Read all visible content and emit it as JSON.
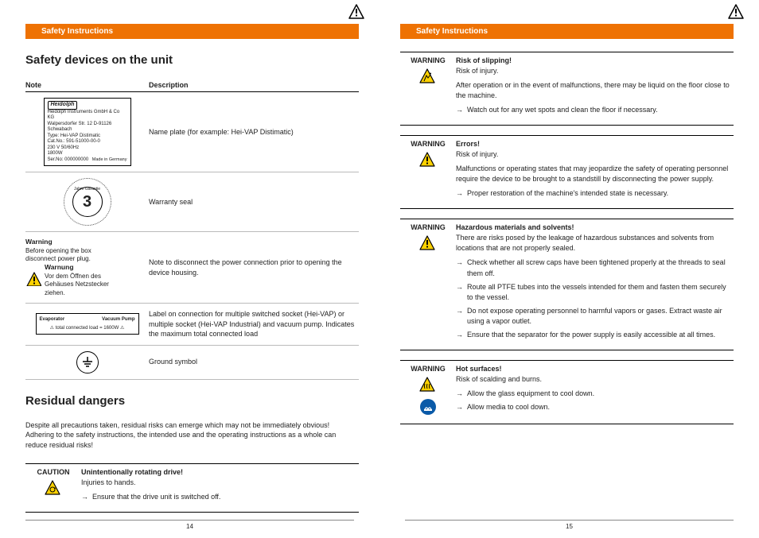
{
  "header": "Safety Instructions",
  "left": {
    "h1": "Safety devices on the unit",
    "th_note": "Note",
    "th_desc": "Description",
    "nameplate": {
      "brand": "Heidolph",
      "company": "Heidolph Instruments GmbH & Co KG",
      "addr": "Walpersdorfer Str. 12 D-91126 Schwabach",
      "type": "Type: Hei-VAP Distimatic",
      "cat": "Cat.No.: 591-51000-00-0",
      "volt": "230 V        50/60Hz",
      "watt": "1800W",
      "ser": "Ser.No: 000000000",
      "made": "Made in Germany"
    },
    "row1_desc": "Name plate (for example: Hei-VAP Distimatic)",
    "warranty_num": "3",
    "warranty_arc": "Jahre Garantie",
    "row2_desc": "Warranty seal",
    "wlabel": {
      "t1": "Warning",
      "l1": "Before opening the box disconnect power plug.",
      "t2": "Warnung",
      "l2": "Vor dem Öffnen des Gehäuses  Netzstecker ziehen."
    },
    "row3_desc": "Note to disconnect the power connection prior to opening the device housing.",
    "socket": {
      "a": "Evaporator",
      "b": "Vacuum Pump",
      "c": "⚠ total connected load = 1600W ⚠"
    },
    "row4_desc": "Label on connection for multiple switched socket (Hei-VAP) or multiple socket (Hei-VAP Industrial) and vacuum pump. Indicates the maximum total connected load",
    "row5_desc": "Ground symbol",
    "h2": "Residual dangers",
    "intro": "Despite all precautions taken, residual risks can emerge which may not be immediately obvious! Adhering to the safety instructions, the intended use and the operating instructions as a whole can reduce residual risks!",
    "caution": {
      "level": "CAUTION",
      "title": "Unintentionally rotating drive!",
      "sub": "Injuries to hands.",
      "items": [
        "Ensure that the drive unit is switched off."
      ]
    },
    "pagenum": "14"
  },
  "right": {
    "w1": {
      "level": "WARNING",
      "title": "Risk of slipping!",
      "sub": "Risk of injury.",
      "p": "After operation or in the event of malfunctions, there may be liquid on the floor close to the machine.",
      "items": [
        "Watch out for any wet spots and clean the floor if necessary."
      ]
    },
    "w2": {
      "level": "WARNING",
      "title": "Errors!",
      "sub": "Risk of injury.",
      "p": "Malfunctions or operating states that may jeopardize the safety of operating personnel require the device to be brought to a standstill by disconnecting the power supply.",
      "items": [
        "Proper restoration of the machine's intended state is necessary."
      ]
    },
    "w3": {
      "level": "WARNING",
      "title": "Hazardous materials and solvents!",
      "p": "There are risks posed by the leakage of hazardous substances and solvents from locations that are not properly sealed.",
      "items": [
        "Check whether all screw caps have been tightened properly at the threads to seal them off.",
        "Route all PTFE tubes into the vessels intended for them and fasten them securely to the vessel.",
        "Do not expose operating personnel to harmful vapors or gases. Extract waste air using a vapor outlet.",
        "Ensure that the separator for the power supply is easily accessible at all times."
      ]
    },
    "w4": {
      "level": "WARNING",
      "title": "Hot surfaces!",
      "sub": "Risk of scalding and burns.",
      "items": [
        "Allow the glass equipment to cool down.",
        "Allow media to cool down."
      ]
    },
    "pagenum": "15"
  }
}
